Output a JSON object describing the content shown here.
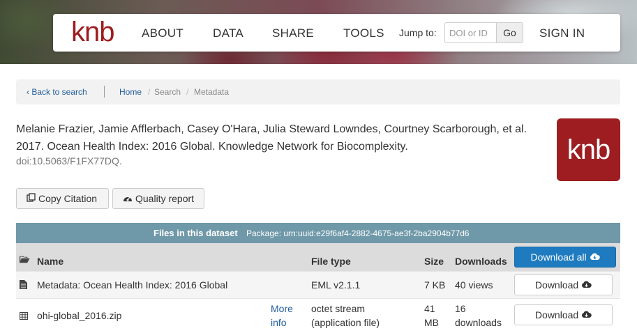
{
  "nav": {
    "logo": "knb",
    "links": [
      "ABOUT",
      "DATA",
      "SHARE",
      "TOOLS"
    ],
    "jump_label": "Jump to:",
    "jump_placeholder": "DOI or ID",
    "go_label": "Go",
    "sign_in": "SIGN IN"
  },
  "breadcrumb": {
    "back": "‹ Back to search",
    "home": "Home",
    "sep": "/",
    "search": "Search",
    "current": "Metadata"
  },
  "citation": {
    "text": "Melanie Frazier, Jamie Afflerbach, Casey O'Hara, Julia Steward Lowndes, Courtney Scarborough, et al. 2017. Ocean Health Index: 2016 Global. Knowledge Network for Biocomplexity.",
    "doi": "doi:10.5063/F1FX77DQ",
    "doi_dot": ".",
    "badge": "knb"
  },
  "actions": {
    "copy_citation": "Copy Citation",
    "quality_report": "Quality report"
  },
  "files": {
    "title": "Files in this dataset",
    "package": "Package: urn:uuid:e29f6af4-2882-4675-ae3f-2ba2904b77d6",
    "columns": {
      "name": "Name",
      "type": "File type",
      "size": "Size",
      "downloads": "Downloads"
    },
    "download_all": "Download all",
    "rows": [
      {
        "name": "Metadata: Ocean Health Index: 2016 Global",
        "more": "",
        "type": "EML v2.1.1",
        "size": "7 KB",
        "downloads": "40 views",
        "button": "Download"
      },
      {
        "name": "ohi-global_2016.zip",
        "more_1": "More",
        "more_2": "info",
        "type_1": "octet stream",
        "type_2": "(application file)",
        "size_1": "41",
        "size_2": "MB",
        "downloads_1": "16",
        "downloads_2": "downloads",
        "button": "Download"
      }
    ]
  },
  "colors": {
    "brand": "#9d1d20",
    "link": "#1f5c9a",
    "files_header": "#6f98a8",
    "primary_button": "#1e7bbf"
  }
}
